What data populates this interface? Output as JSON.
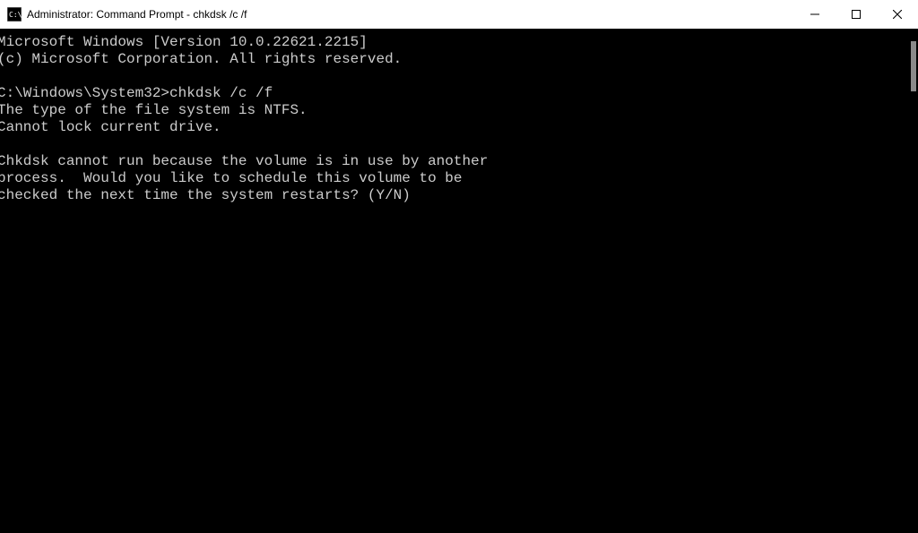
{
  "titlebar": {
    "title": "Administrator: Command Prompt - chkdsk  /c /f"
  },
  "console": {
    "lines": [
      "Microsoft Windows [Version 10.0.22621.2215]",
      "(c) Microsoft Corporation. All rights reserved.",
      "",
      "C:\\Windows\\System32>chkdsk /c /f",
      "The type of the file system is NTFS.",
      "Cannot lock current drive.",
      "",
      "Chkdsk cannot run because the volume is in use by another",
      "process.  Would you like to schedule this volume to be",
      "checked the next time the system restarts? (Y/N)"
    ]
  }
}
